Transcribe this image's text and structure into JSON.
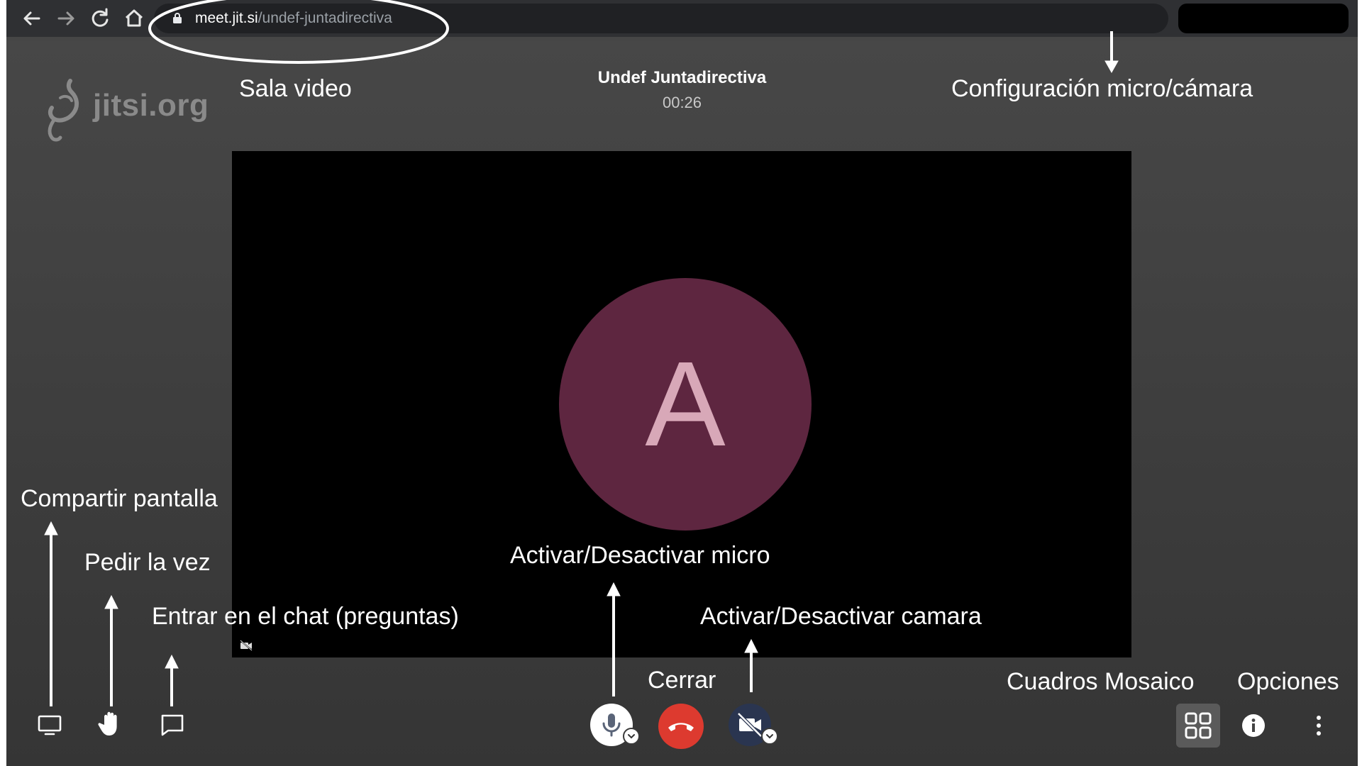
{
  "browser": {
    "url_host": "meet.jit.si",
    "url_path": "/undef-juntadirectiva",
    "icons": [
      "back-arrow-icon",
      "forward-arrow-icon",
      "reload-icon",
      "home-icon",
      "lock-icon",
      "camera-in-use-icon",
      "star-icon"
    ]
  },
  "meeting": {
    "logo_text": "jitsi.org",
    "title": "Undef Juntadirectiva",
    "timer": "00:26",
    "avatar_initial": "A"
  },
  "toolbar": {
    "icons": [
      "screen-share-icon",
      "raise-hand-icon",
      "chat-icon",
      "microphone-icon",
      "hangup-icon",
      "camera-off-icon",
      "tile-view-icon",
      "info-icon",
      "more-options-icon"
    ]
  },
  "annotations": {
    "sala_video": "Sala video",
    "config": "Configuración micro/cámara",
    "compartir": "Compartir pantalla",
    "pedir": "Pedir la vez",
    "chat": "Entrar en el chat (preguntas)",
    "micro": "Activar/Desactivar micro",
    "cerrar": "Cerrar",
    "camara": "Activar/Desactivar camara",
    "mosaico": "Cuadros Mosaico",
    "opciones": "Opciones"
  },
  "colors": {
    "avatar_bg": "#5e2640",
    "hangup": "#dd3a2f",
    "camera_btn": "#2a3550",
    "background": "#434343"
  }
}
